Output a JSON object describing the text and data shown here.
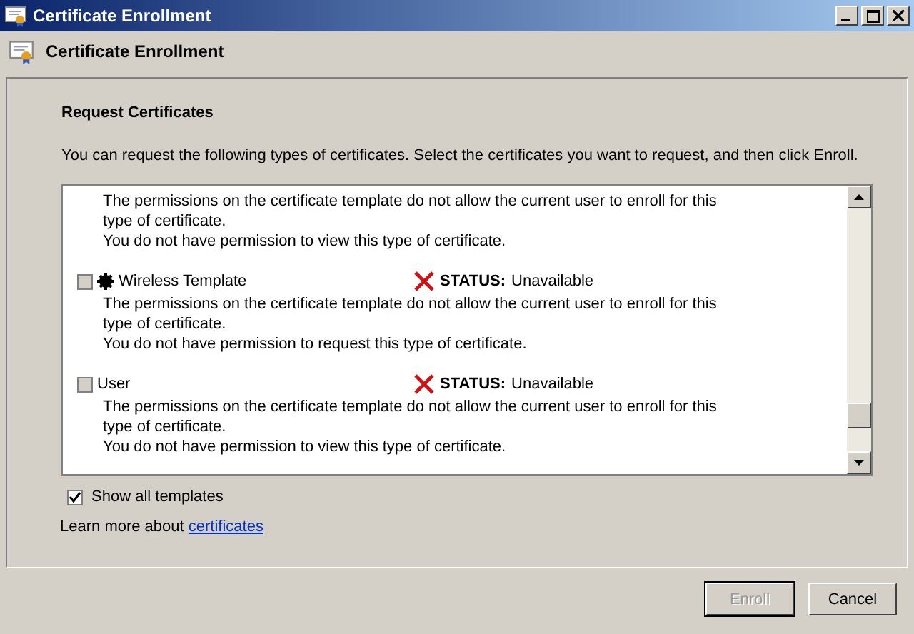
{
  "window": {
    "title": "Certificate Enrollment"
  },
  "header": {
    "title": "Certificate Enrollment"
  },
  "section": {
    "title": "Request Certificates",
    "description": "You can request the following types of certificates. Select the certificates you want to request, and then click Enroll."
  },
  "templates": [
    {
      "kind": "partial",
      "lines": [
        "The permissions on the certificate template do not allow the current user to enroll for this type of certificate.",
        "You do not have permission to view this type of certificate."
      ]
    },
    {
      "kind": "full",
      "checked": false,
      "icon": true,
      "name": "Wireless Template",
      "status_label": "STATUS:",
      "status_value": "Unavailable",
      "lines": [
        "The permissions on the certificate template do not allow the current user to enroll for this type of certificate.",
        "You do not have permission to request this type of certificate."
      ]
    },
    {
      "kind": "full",
      "checked": false,
      "icon": false,
      "name": "User",
      "status_label": "STATUS:",
      "status_value": "Unavailable",
      "lines": [
        "The permissions on the certificate template do not allow the current user to enroll for this type of certificate.",
        "You do not have permission to view this type of certificate."
      ]
    }
  ],
  "show_all": {
    "label": "Show all templates",
    "checked": true
  },
  "learn_more": {
    "text": "Learn more about",
    "link": "certificates"
  },
  "buttons": [
    {
      "label": "Enroll",
      "disabled": true
    },
    {
      "label": "Cancel",
      "disabled": false
    }
  ]
}
